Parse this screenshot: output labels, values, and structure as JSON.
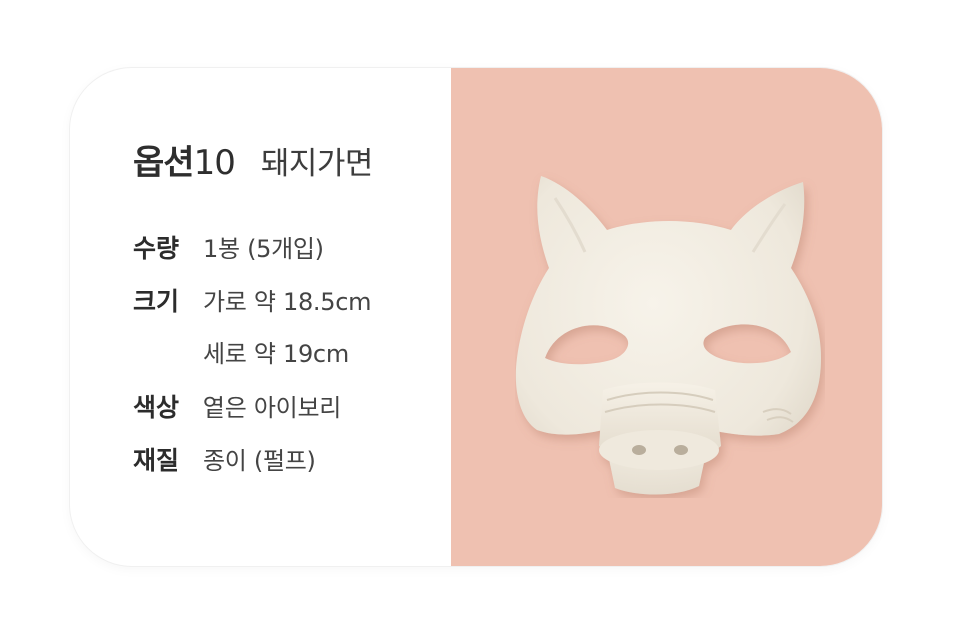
{
  "product": {
    "option_label": "옵션",
    "option_number": "10",
    "name": "돼지가면"
  },
  "specs": [
    {
      "key": "수량",
      "value": "1봉 (5개입)"
    },
    {
      "key": "크기",
      "value": "가로 약 18.5cm"
    },
    {
      "key": "",
      "value": "세로 약 19cm"
    },
    {
      "key": "색상",
      "value": "옅은 아이보리"
    },
    {
      "key": "재질",
      "value": "종이 (펄프)"
    }
  ],
  "colors": {
    "photo_background": "#efc1b1",
    "mask": "#f2ede2"
  },
  "image": {
    "subject_icon": "pig-mask-image"
  }
}
